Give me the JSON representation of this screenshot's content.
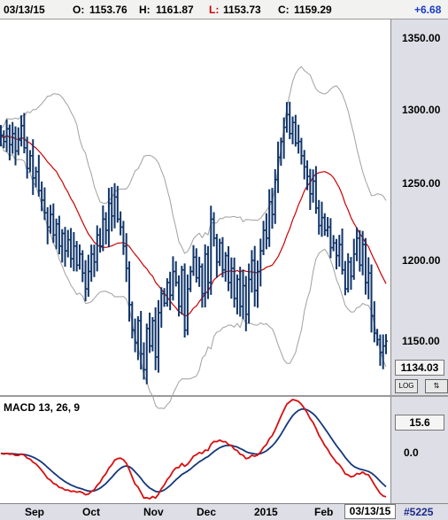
{
  "header": {
    "date": "03/13/15",
    "open_label": "O:",
    "open": "1153.76",
    "high_label": "H:",
    "high": "1161.87",
    "low_label": "L:",
    "low": "1153.73",
    "close_label": "C:",
    "close": "1159.29",
    "change": "+6.68"
  },
  "price_axis": {
    "ticks": [
      "1350.00",
      "1300.00",
      "1250.00",
      "1200.00",
      "1150.00"
    ],
    "last_price": "1134.03"
  },
  "buttons": {
    "log": "LOG",
    "scale": "⇅"
  },
  "macd": {
    "label": "MACD 13, 26, 9",
    "value": "15.6",
    "zero": "0.0"
  },
  "time_axis": {
    "months": [
      "Sep",
      "Oct",
      "Nov",
      "Dec",
      "2015",
      "Feb"
    ],
    "current_date": "03/13/15",
    "code": "#5225"
  },
  "colors": {
    "bars": "#10356a",
    "sma": "#cc0000",
    "bands": "#a0a0a0",
    "macd_line": "#14387a",
    "signal_line": "#d81010",
    "up_change": "#1a3cc8",
    "low_label": "#cc0000"
  },
  "chart_data": {
    "type": "ohlc-bar",
    "ylim": [
      1125,
      1362
    ],
    "close_series": [
      1289,
      1285,
      1293,
      1283,
      1290,
      1279,
      1286,
      1295,
      1281,
      1268,
      1276,
      1262,
      1266,
      1254,
      1248,
      1240,
      1231,
      1239,
      1226,
      1233,
      1219,
      1227,
      1216,
      1223,
      1211,
      1219,
      1207,
      1214,
      1202,
      1192,
      1203,
      1214,
      1209,
      1226,
      1219,
      1236,
      1229,
      1246,
      1238,
      1250,
      1236,
      1231,
      1219,
      1205,
      1182,
      1166,
      1158,
      1172,
      1151,
      1141,
      1167,
      1156,
      1172,
      1149,
      1177,
      1189,
      1183,
      1196,
      1188,
      1203,
      1196,
      1181,
      1204,
      1166,
      1192,
      1203,
      1212,
      1199,
      1206,
      1189,
      1214,
      1196,
      1236,
      1224,
      1209,
      1221,
      1204,
      1213,
      1196,
      1205,
      1186,
      1198,
      1181,
      1194,
      1176,
      1198,
      1210,
      1191,
      1203,
      1216,
      1229,
      1224,
      1247,
      1239,
      1261,
      1275,
      1285,
      1294,
      1302,
      1290,
      1297,
      1284,
      1285,
      1276,
      1269,
      1263,
      1252,
      1260,
      1243,
      1232,
      1237,
      1229,
      1231,
      1218,
      1221,
      1213,
      1220,
      1204,
      1192,
      1209,
      1200,
      1214,
      1224,
      1207,
      1220,
      1196,
      1202,
      1175,
      1164,
      1160,
      1152,
      1156,
      1159
    ]
  }
}
